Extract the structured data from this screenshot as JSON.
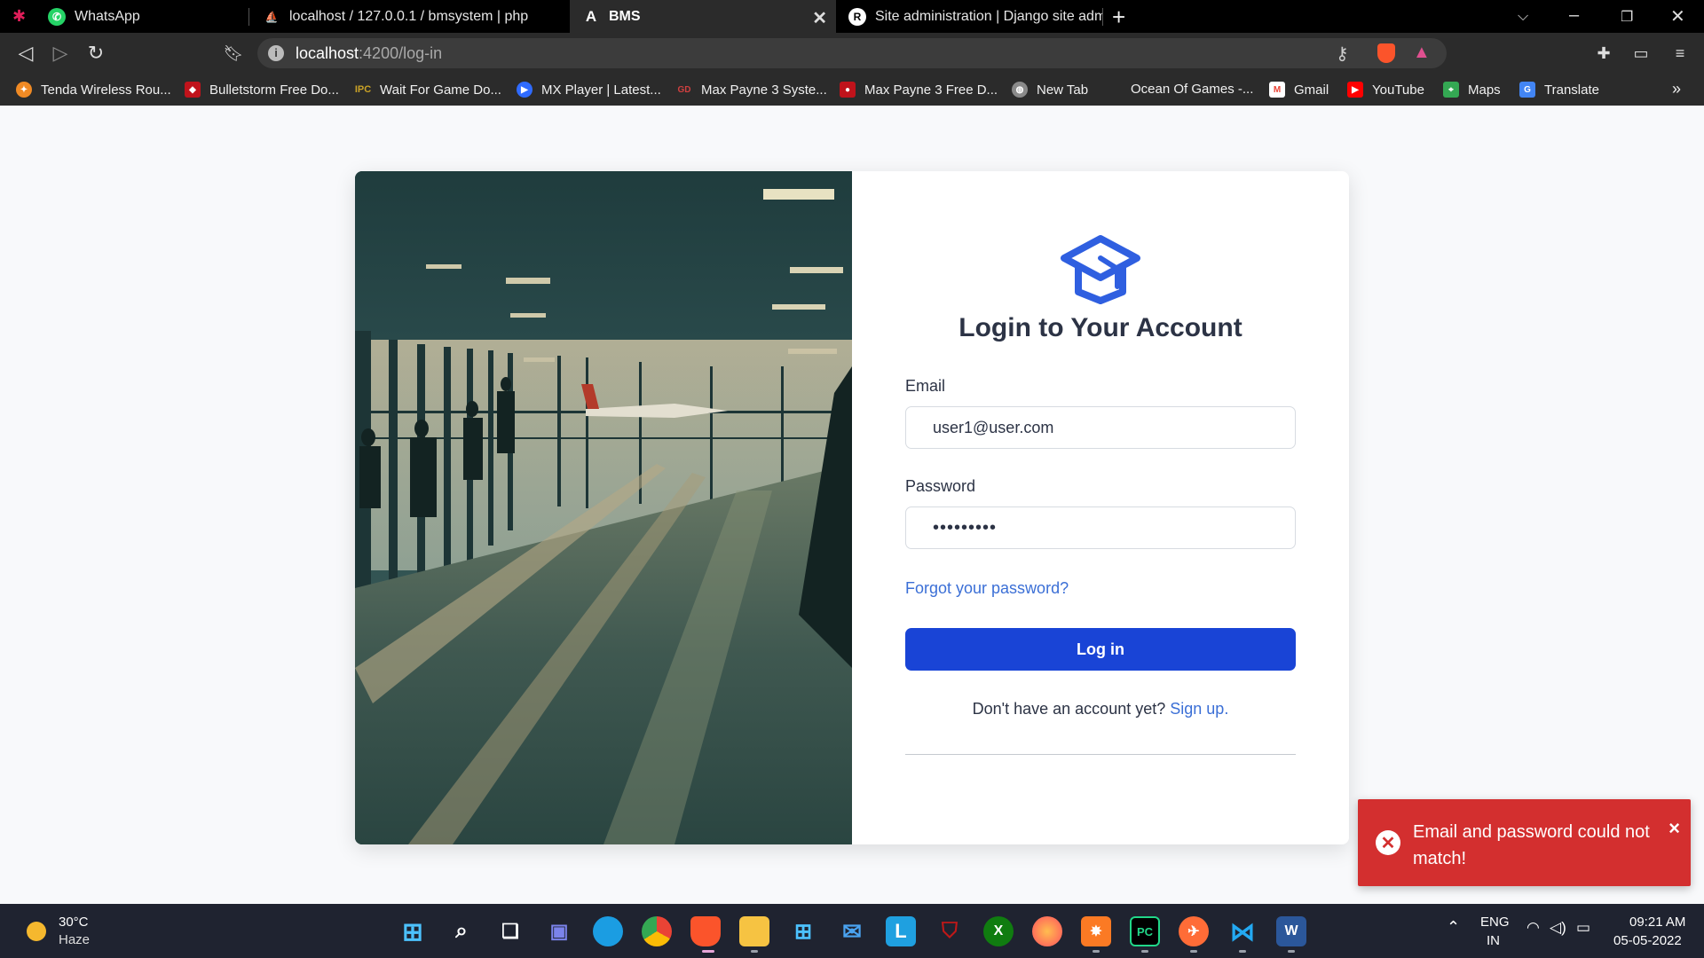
{
  "browser": {
    "tabs": [
      {
        "title": "WhatsApp",
        "icon": "whatsapp-icon",
        "color": "#25d366"
      },
      {
        "title": "localhost / 127.0.0.1 / bmsystem | php",
        "icon": "phpmyadmin-icon",
        "color": "#f0a030"
      },
      {
        "title": "BMS",
        "icon": "angular-icon",
        "color": "#ffffff"
      },
      {
        "title": "Site administration | Django site admin",
        "icon": "django-icon",
        "color": "#ffffff"
      }
    ],
    "url_host": "localhost",
    "url_path": ":4200/log-in",
    "bookmarks": [
      {
        "label": "Tenda Wireless Rou...",
        "color": "#f08a24"
      },
      {
        "label": "Bulletstorm Free Do...",
        "color": "#c0131b"
      },
      {
        "label": "Wait For Game Do...",
        "color": "#c9a227"
      },
      {
        "label": "MX Player | Latest...",
        "color": "#2f6bff"
      },
      {
        "label": "Max Payne 3 Syste...",
        "color": "#d04040"
      },
      {
        "label": "Max Payne 3 Free D...",
        "color": "#c0131b"
      },
      {
        "label": "New Tab",
        "color": "#8a8a8a"
      },
      {
        "label": "Ocean Of Games -...",
        "color": "#2b2b2b"
      },
      {
        "label": "Gmail",
        "color": "#ea4335"
      },
      {
        "label": "YouTube",
        "color": "#ff0000"
      },
      {
        "label": "Maps",
        "color": "#34a853"
      },
      {
        "label": "Translate",
        "color": "#4285f4"
      }
    ]
  },
  "login": {
    "title": "Login to Your Account",
    "email_label": "Email",
    "email_value": "user1@user.com",
    "password_label": "Password",
    "password_value": "•••••••••",
    "forgot": "Forgot your password?",
    "button": "Log in",
    "signup_prompt": "Don't have an account yet?",
    "signup_link": "Sign up."
  },
  "toast": {
    "message": "Email and password could not match!",
    "close": "×",
    "color": "#d32f2f"
  },
  "taskbar": {
    "temperature": "30°C",
    "weather": "Haze",
    "language": "ENG",
    "region": "IN",
    "time": "09:21 AM",
    "date": "05-05-2022"
  },
  "colors": {
    "accent": "#1944d6",
    "link": "#3b6fd6",
    "heading": "#2c3345"
  }
}
